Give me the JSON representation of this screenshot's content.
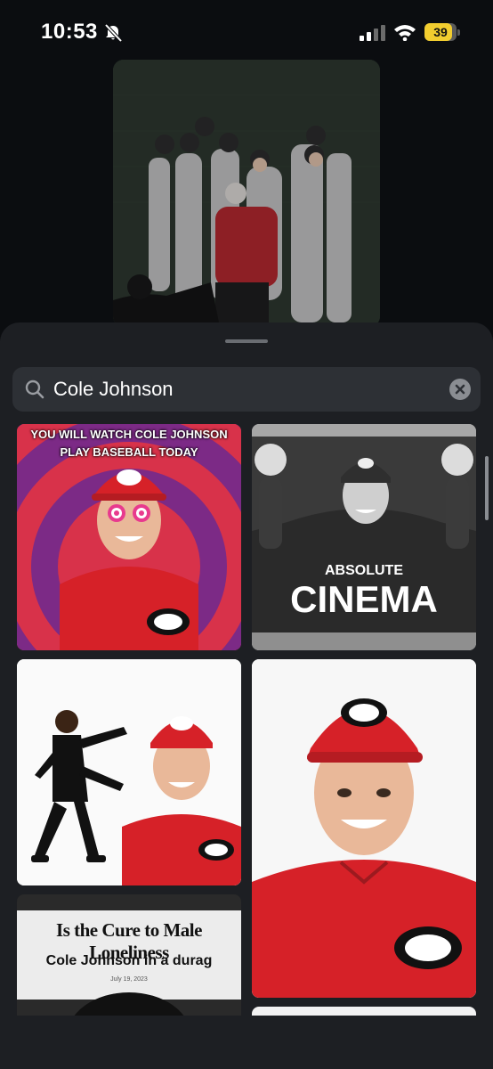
{
  "status": {
    "time": "10:53",
    "battery": "39",
    "battery_level": 0.39,
    "icons": [
      "bell-slash-icon",
      "signal-icon",
      "wifi-icon",
      "battery-icon"
    ]
  },
  "preview": {
    "icon": "video-preview"
  },
  "search": {
    "value": "Cole Johnson",
    "icon": "search-icon",
    "clear_icon": "clear-icon"
  },
  "results": [
    {
      "caption": "YOU WILL WATCH COLE JOHNSON PLAY BASEBALL TODAY"
    },
    {
      "caption_top": "ABSOLUTE",
      "caption_bottom": "CINEMA"
    },
    {
      "caption": ""
    },
    {
      "caption": ""
    },
    {
      "headline": "Is the Cure to Male Loneliness",
      "subline": "Cole Johnson in a durag",
      "date": "July 19, 2023"
    }
  ],
  "colors": {
    "sheet": "#1d1f23",
    "search_bg": "#2d3035",
    "accent_red": "#d0202a",
    "battery": "#f2cd2f"
  }
}
